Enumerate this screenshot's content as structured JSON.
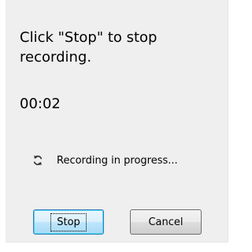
{
  "dialog": {
    "instruction": "Click \"Stop\" to stop recording.",
    "timer": "00:02",
    "status": {
      "icon": "refresh-icon",
      "text": "Recording in progress..."
    },
    "buttons": {
      "stop_label": "Stop",
      "cancel_label": "Cancel"
    }
  }
}
